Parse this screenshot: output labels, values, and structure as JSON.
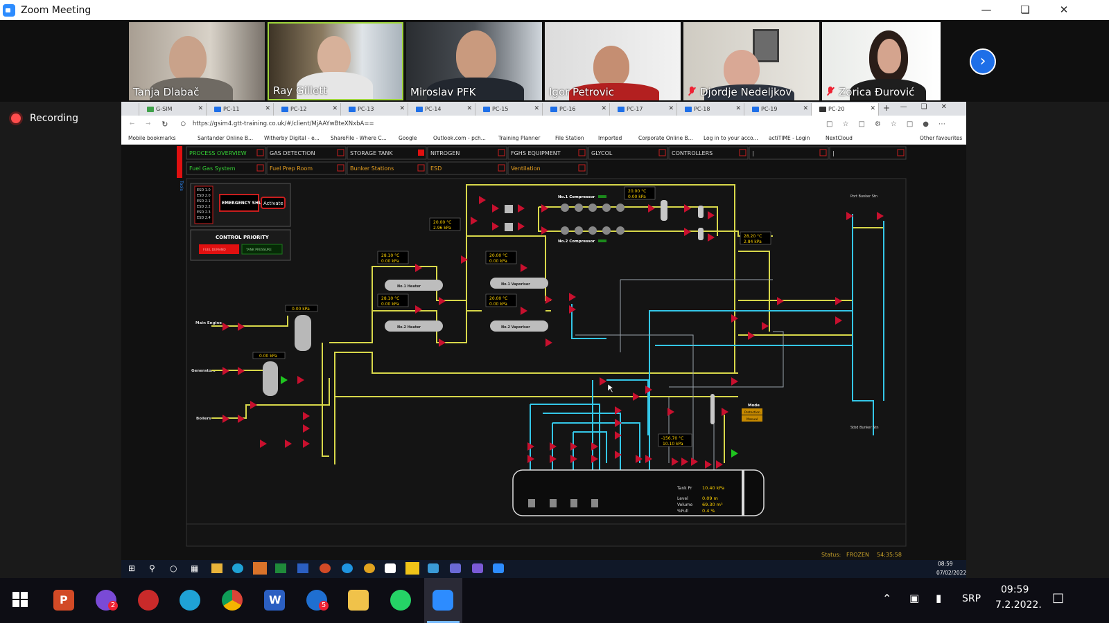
{
  "window": {
    "title": "Zoom Meeting"
  },
  "participants": [
    {
      "name": "Tanja Dlabač",
      "muted": false
    },
    {
      "name": "Ray Gillett",
      "muted": false
    },
    {
      "name": "Miroslav PFK",
      "muted": false
    },
    {
      "name": "Igor Petrovic",
      "muted": false
    },
    {
      "name": "Djordje Nedeljkov",
      "muted": true
    },
    {
      "name": "Zorica Đurović",
      "muted": true
    }
  ],
  "recording": {
    "label": "Recording"
  },
  "browser": {
    "tabs": [
      "G-SIM",
      "PC-11",
      "PC-12",
      "PC-13",
      "PC-14",
      "PC-15",
      "PC-16",
      "PC-17",
      "PC-18",
      "PC-19",
      "PC-20"
    ],
    "url": "https://gsim4.gtt-training.co.uk/#/client/MjAAYwBteXNxbA==",
    "bookmarks": [
      "Mobile bookmarks",
      "Santander Online B...",
      "Witherby Digital - e...",
      "ShareFile - Where C...",
      "Google",
      "Outlook.com - pch...",
      "Training Planner",
      "File Station",
      "Imported",
      "Corporate Online B...",
      "Log in to your acco...",
      "actiTIME - Login",
      "NextCloud",
      "Other favourites"
    ]
  },
  "sim": {
    "nav_row1": [
      "PROCESS OVERVIEW",
      "GAS DETECTION",
      "STORAGE TANK",
      "NITROGEN",
      "FGHS EQUIPMENT",
      "GLYCOL",
      "CONTROLLERS",
      "|",
      "|"
    ],
    "nav_row2": [
      "Fuel Gas System",
      "Fuel Prep Room",
      "Bunker Stations",
      "ESD",
      "Ventilation"
    ],
    "esd_levels": [
      "ESD 1.0",
      "ESD 2.0",
      "ESD 2.1",
      "ESD 2.2",
      "ESD 2.3",
      "ESD 2.4"
    ],
    "esd_button": "EMERGENCY SHUTDOWN",
    "activate": "Activate",
    "control_priority": "CONTROL PRIORITY",
    "priority_opts": [
      "FUEL DEMAND",
      "TANK PRESSURE"
    ],
    "consumers": [
      "Main Engine",
      "Generators",
      "Boilers"
    ],
    "equipment": [
      "No.1 Compressor",
      "No.2 Compressor",
      "No.1 Heater",
      "No.2 Heater",
      "No.1 Vaporiser",
      "No.2 Vaporiser",
      "Port Bunker Stn",
      "Stbd Bunker Stn",
      "Mode"
    ],
    "mode_values": [
      "Protection",
      "Manual"
    ],
    "readouts": [
      "20.00 °C",
      "0.00 kPa",
      "20.00 °C",
      "2.96 kPa",
      "28.10 °C",
      "0.00 kPa",
      "28.10 °C",
      "0.00 kPa",
      "20.00 °C",
      "0.00 kPa",
      "20.00 °C",
      "0.00 kPa",
      "28.20 °C",
      "2.84 kPa",
      "0.00 kPa",
      "0.00 kPa",
      "-156.70 °C",
      "10.10 kPa"
    ],
    "tank": {
      "pressure_label": "Tank Pr",
      "pressure": "10.40 kPa",
      "level_label": "Level",
      "level": "0.09 m",
      "volume_label": "Volume",
      "volume": "69.30 m³",
      "full_label": "%Full",
      "full": "0.4 %"
    },
    "status": {
      "label": "Status:",
      "value": "FROZEN",
      "time": "54:35:58"
    }
  },
  "inner_clock": {
    "time": "08:59",
    "date": "07/02/2022"
  },
  "taskbar": {
    "lang": "SRP",
    "time": "09:59",
    "date": "7.2.2022.",
    "badges": [
      "2",
      "5"
    ]
  },
  "colors": {
    "accent": "#2d8cff",
    "pipe_gas": "#d8d84a",
    "pipe_lng": "#34c7e8",
    "valve": "#c8102e"
  }
}
